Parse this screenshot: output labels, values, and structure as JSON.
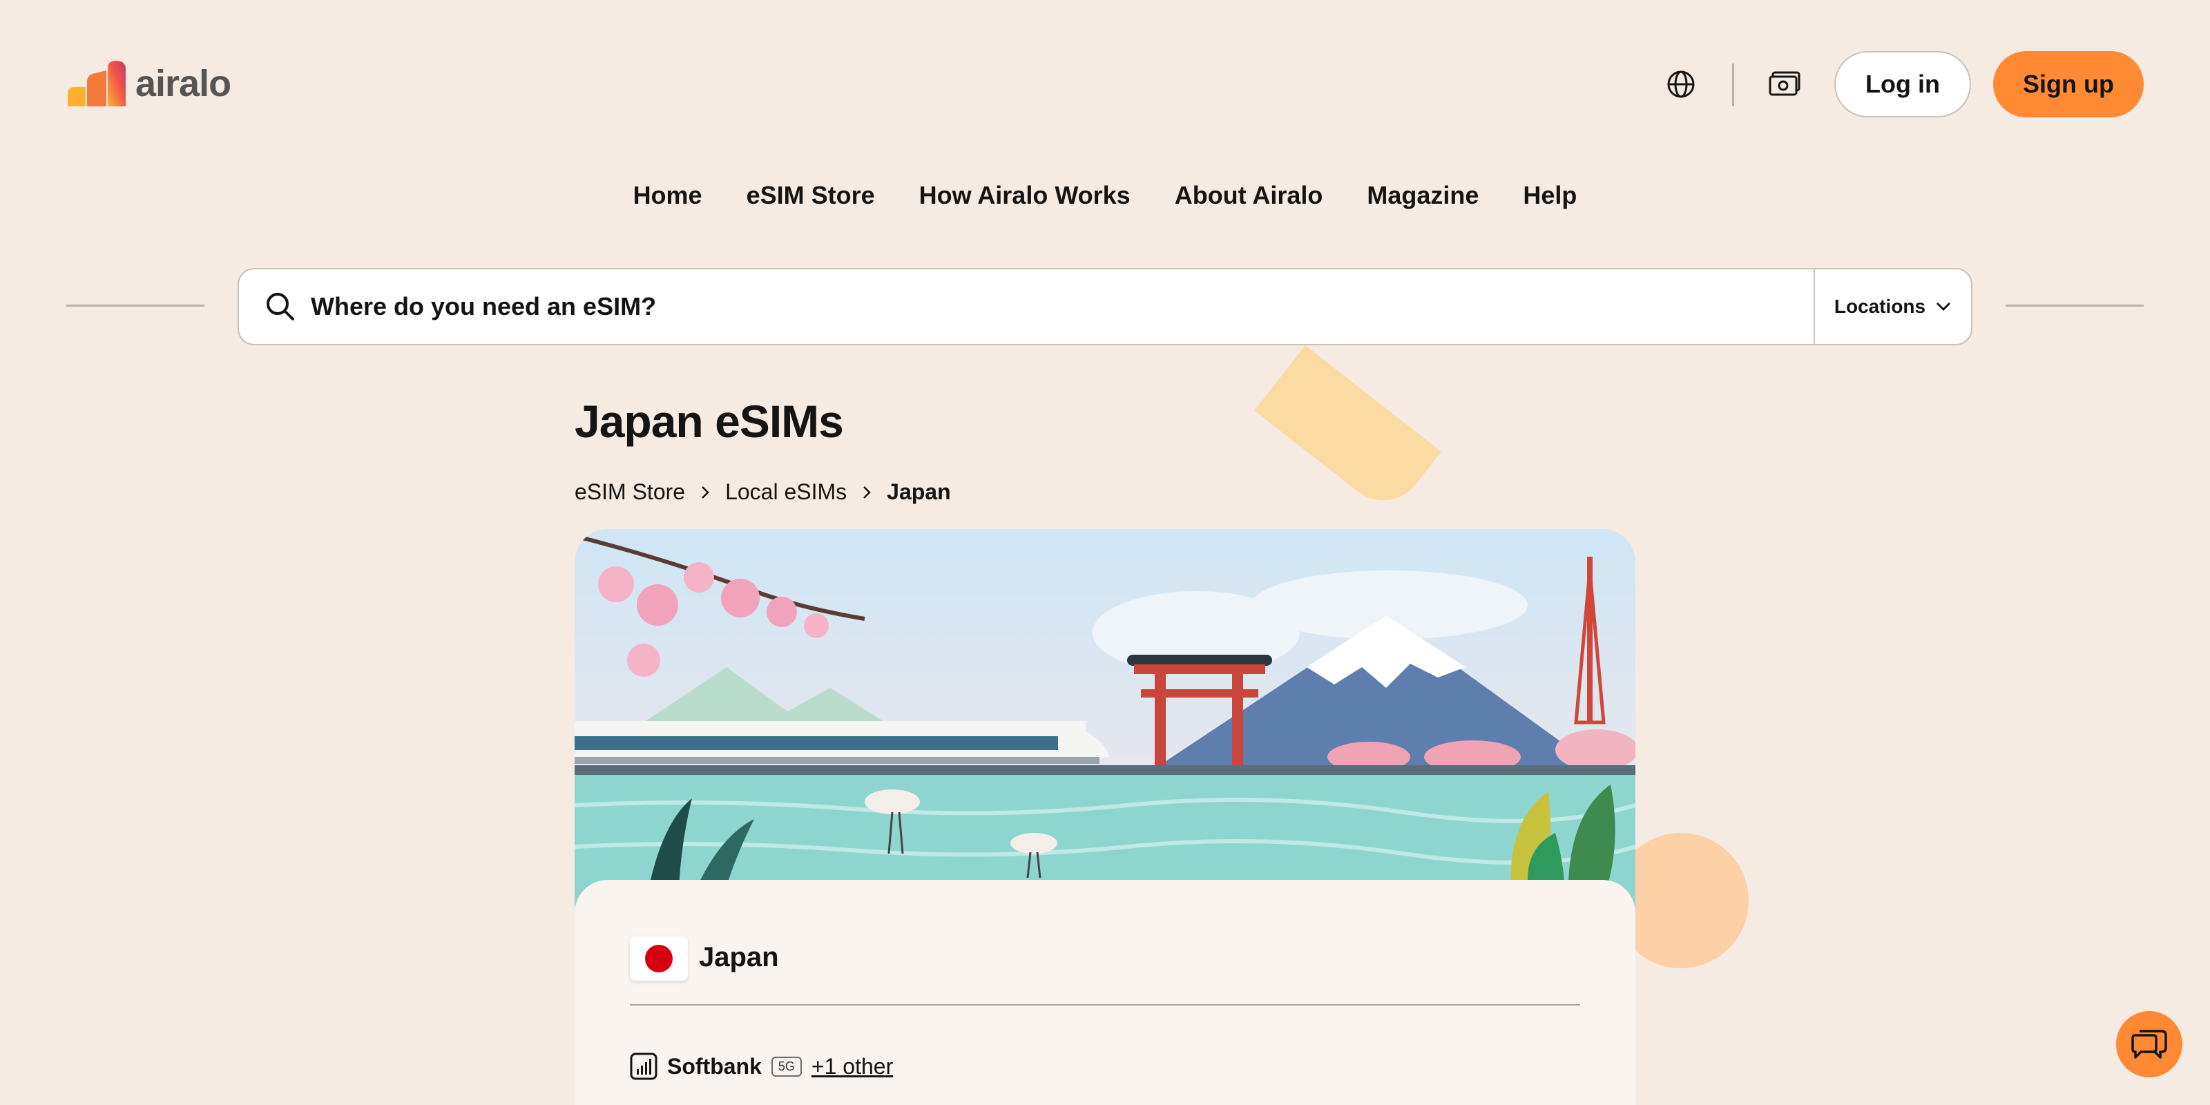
{
  "brand": {
    "name": "airalo"
  },
  "header": {
    "globe_icon": "globe-icon",
    "currency_icon": "money-icon",
    "login_label": "Log in",
    "signup_label": "Sign up",
    "accent_color": "#ff8a33"
  },
  "nav": {
    "items": [
      "Home",
      "eSIM Store",
      "How Airalo Works",
      "About Airalo",
      "Magazine",
      "Help"
    ]
  },
  "search": {
    "placeholder": "Where do you need an eSIM?",
    "dropdown_label": "Locations"
  },
  "page": {
    "title": "Japan eSIMs",
    "breadcrumbs": [
      "eSIM Store",
      "Local eSIMs",
      "Japan"
    ]
  },
  "card": {
    "country": "Japan",
    "network_name": "Softbank",
    "network_badge": "5G",
    "other_link": "+1 other"
  }
}
